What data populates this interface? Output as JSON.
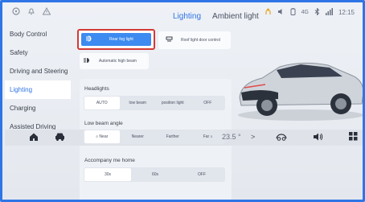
{
  "status": {
    "tabs": [
      {
        "label": "Lighting",
        "active": true
      },
      {
        "label": "Ambient light",
        "active": false
      }
    ],
    "network": "4G",
    "time": "12:15",
    "icons": [
      "steering-wheel-icon",
      "bell-icon",
      "warning-triangle-icon",
      "seatbelt-icon",
      "speaker-icon",
      "battery-icon",
      "bluetooth-icon",
      "signal-icon"
    ]
  },
  "sidebar": {
    "items": [
      {
        "label": "Body Control",
        "active": false
      },
      {
        "label": "Safety",
        "active": false
      },
      {
        "label": "Driving and Steering",
        "active": false
      },
      {
        "label": "Lighting",
        "active": true
      },
      {
        "label": "Charging",
        "active": false
      },
      {
        "label": "Assisted Driving",
        "active": false
      }
    ]
  },
  "controls": {
    "rear_fog_label": "Rear fog light",
    "roof_light_label": "Roof light door control",
    "auto_beam_label": "Automatic high beam"
  },
  "panel": {
    "headlights": {
      "title": "Headlights",
      "options": [
        "AUTO",
        "low beam",
        "position light",
        "OFF"
      ],
      "selected": "AUTO"
    },
    "low_beam_angle": {
      "title": "Low beam angle",
      "options": [
        "Near",
        "Nearer",
        "Farther",
        "Far"
      ],
      "selected": "Near",
      "far_badge": "3"
    },
    "accompany": {
      "title": "Accompany me home",
      "options": [
        "30s",
        "60s",
        "OFF"
      ],
      "selected": "30s"
    }
  },
  "dock": {
    "temperature": "23.5 °",
    "arrow": ">"
  },
  "colors": {
    "accent": "#2f75e6",
    "active_button": "#3d8bf0",
    "highlight_border": "#d33a35"
  }
}
